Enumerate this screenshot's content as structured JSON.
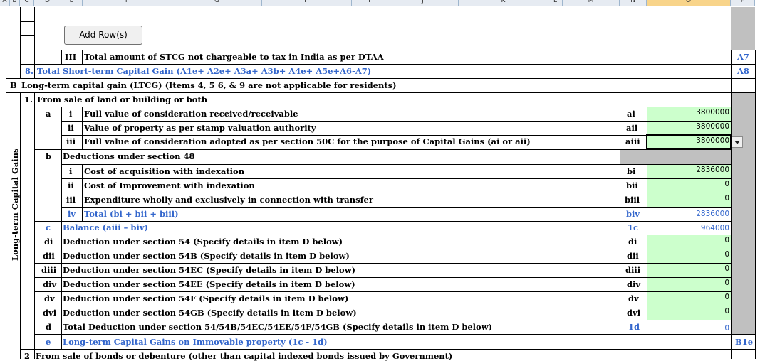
{
  "columns": [
    "A",
    "B",
    "C",
    "D",
    "E",
    "F",
    "G",
    "H",
    "I",
    "J",
    "K",
    "L",
    "M",
    "N",
    "O",
    "P"
  ],
  "button": {
    "add_rows": "Add Row(s)"
  },
  "section_side_label": "Long-term Capital Gains",
  "rows": {
    "r_iii_stcg": {
      "num": "III",
      "text": "Total amount of STCG not chargeable to tax in India as per DTAA",
      "ref": "A7"
    },
    "r8": {
      "num": "8.",
      "text": "Total Short-term Capital Gain (A1e+ A2e+ A3a+ A3b+ A4e+ A5e+A6-A7)",
      "ref": "A8"
    },
    "rB": {
      "num": "B",
      "text": "Long-term capital gain (LTCG) (Items 4, 5 6, & 9 are not applicable for residents)"
    },
    "r1": {
      "num": "1.",
      "text": "From sale of land or building or both"
    },
    "a_i": {
      "letter": "a",
      "num": "i",
      "text": "Full value of consideration received/receivable",
      "code": "ai",
      "value": "3800000"
    },
    "a_ii": {
      "num": "ii",
      "text": "Value of property as per stamp valuation authority",
      "code": "aii",
      "value": "3800000"
    },
    "a_iii": {
      "num": "iii",
      "text": "Full value of consideration adopted as per section 50C for the purpose of Capital Gains (ai or aii)",
      "code": "aiii",
      "value": "3800000"
    },
    "b": {
      "letter": "b",
      "text": "Deductions under section 48"
    },
    "b_i": {
      "num": "i",
      "text": "Cost of acquisition with indexation",
      "code": "bi",
      "value": "2836000"
    },
    "b_ii": {
      "num": "ii",
      "text": "Cost of Improvement with indexation",
      "code": "bii",
      "value": "0"
    },
    "b_iii": {
      "num": "iii",
      "text": "Expenditure wholly and exclusively in connection with transfer",
      "code": "biii",
      "value": "0"
    },
    "b_iv": {
      "num": "iv",
      "text": "Total (bi + bii + biii)",
      "code": "biv",
      "value": "2836000"
    },
    "c": {
      "letter": "c",
      "text": "Balance (aiii – biv)",
      "code": "1c",
      "value": "964000"
    },
    "di": {
      "letter": "di",
      "text": "Deduction under section 54 (Specify details in item D below)",
      "code": "di",
      "value": "0"
    },
    "dii": {
      "letter": "dii",
      "text": "Deduction under section 54B (Specify details in item D below)",
      "code": "dii",
      "value": "0"
    },
    "diii": {
      "letter": "diii",
      "text": "Deduction under section 54EC (Specify details in item D below)",
      "code": "diii",
      "value": "0"
    },
    "div": {
      "letter": "div",
      "text": "Deduction under section 54EE (Specify details in item D below)",
      "code": "div",
      "value": "0"
    },
    "dv": {
      "letter": "dv",
      "text": "Deduction under section 54F  (Specify details in item D below)",
      "code": "dv",
      "value": "0"
    },
    "dvi": {
      "letter": "dvi",
      "text": "Deduction under section 54GB  (Specify details in item D below)",
      "code": "dvi",
      "value": "0"
    },
    "d": {
      "letter": "d",
      "text": "Total Deduction under section 54/54B/54EC/54EE/54F/54GB  (Specify details in item D below)",
      "code": "1d",
      "value": "0"
    },
    "e": {
      "letter": "e",
      "text": "Long-term Capital Gains on Immovable property (1c - 1d)",
      "ref": "B1e"
    },
    "r2": {
      "num": "2",
      "text": "From sale of bonds or debenture (other than capital indexed bonds issued by Government)"
    }
  },
  "colors": {
    "label_blue": "#3366cc",
    "input_green": "#ccffcc",
    "locked_gray": "#c0c0c0",
    "selected_col": "#f8d48a"
  }
}
